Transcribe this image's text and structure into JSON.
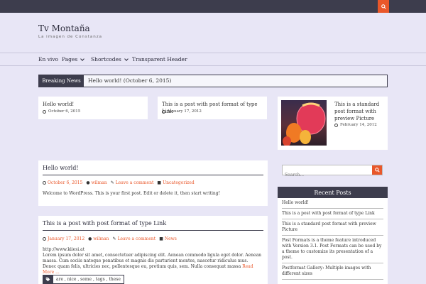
{
  "site": {
    "title": "Tv Montaña",
    "tagline": "La imagen de Constanza"
  },
  "nav": {
    "items": [
      {
        "label": "En vivo"
      },
      {
        "label": "Pages"
      },
      {
        "label": "Shortcodes"
      },
      {
        "label": "Transparent Header"
      }
    ]
  },
  "breaking": {
    "label": "Breaking News",
    "text": "Hello world! (October 6, 2015)"
  },
  "featured": [
    {
      "title": "Hello world!",
      "date": "October 6, 2015"
    },
    {
      "title": "This is a post with post format of type Link",
      "date": "January 17, 2012"
    },
    {
      "title": "This is a standard post format with preview Picture",
      "date": "February 14, 2012"
    }
  ],
  "posts": [
    {
      "title": "Hello world!",
      "date": "October 6, 2015",
      "author": "wilman",
      "comments": "Leave a comment",
      "category": "Uncategorized",
      "excerpt": "Welcome to WordPress. This is your first post. Edit or delete it, then start writing!"
    },
    {
      "title": "This is a post with post format of type Link",
      "date": "January 17, 2012",
      "author": "wilman",
      "comments": "Leave a comment",
      "category": "News",
      "link": "http://www.kiiesi.at",
      "excerpt": "Lorem ipsum dolor sit amet, consectetuer adipiscing elit. Aenean commodo ligula eget dolor. Aenean massa. Cum sociis natoque penatibus et magnis dis parturient montes, nascetur ridiculus mus. Donec quam felis, ultricies nec, pellentesque eu, pretium quis, sem. Nulla consequat massa",
      "read_more": "Read More ...",
      "tags": "are , nice , some , tags , these"
    }
  ],
  "sidebar": {
    "search_placeholder": "Search...",
    "recent_title": "Recent Posts",
    "recent_posts": [
      "Hello world!",
      "This is a post with post format of type Link",
      "This is a standard post format with preview Picture",
      "Post Formats is a theme feature introduced with Version 3.1. Post Formats can be used by a theme to customize its presentation of a post.",
      "Postformat Gallery: Multiple images with different sizes"
    ]
  },
  "colors": {
    "accent": "#e9572a",
    "dark": "#3d3d4d",
    "background": "#e8e6f6"
  }
}
